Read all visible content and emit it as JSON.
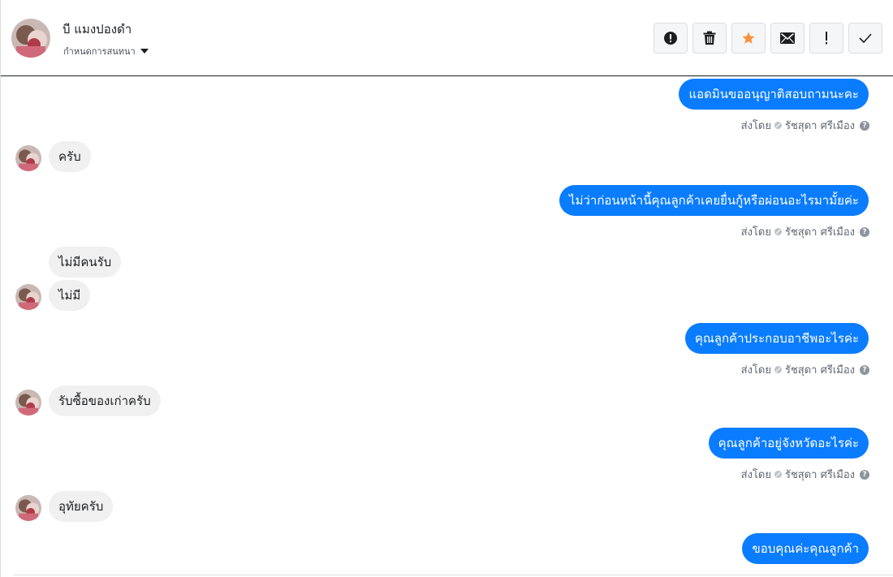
{
  "header": {
    "contact_name": "บี แมงปองดำ",
    "assign_label": "กำหนดการสนทนา",
    "action_icons": [
      "alert-circle-icon",
      "trash-icon",
      "star-icon",
      "envelope-icon",
      "exclamation-icon",
      "checkmark-icon"
    ],
    "star_color": "#f7923a"
  },
  "sent_by": {
    "prefix": "ส่งโดย",
    "name": "รัชสุดา ศรีเมือง"
  },
  "messages": [
    {
      "dir": "out",
      "text": "แอดมินขออนุญาติสอบถามนะคะ",
      "sent_by": true
    },
    {
      "dir": "in",
      "text": "ครับ",
      "avatar": true
    },
    {
      "dir": "out",
      "text": "ไม่ว่าก่อนหน้านี้คุณลูกค้าเคยยื่นกู้หรือผ่อนอะไรมามั้ยค่ะ",
      "sent_by": true
    },
    {
      "dir": "in",
      "text": "ไม่มีคนรับ",
      "avatar": false
    },
    {
      "dir": "in",
      "text": "ไม่มี",
      "avatar": true
    },
    {
      "dir": "out",
      "text": "คุณลูกค้าประกอบอาชีพอะไรค่ะ",
      "sent_by": true
    },
    {
      "dir": "in",
      "text": "รับซื้อของเก่าครับ",
      "avatar": true
    },
    {
      "dir": "out",
      "text": "คุณลูกค้าอยู่จังหวัดอะไรค่ะ",
      "sent_by": true
    },
    {
      "dir": "in",
      "text": "อุทัยครับ",
      "avatar": true
    },
    {
      "dir": "out",
      "text": "ขอบคุณค่ะคุณลูกค้า",
      "sent_by": false
    }
  ],
  "colors": {
    "outgoing_bubble": "#0a7cff",
    "incoming_bubble": "#f0f0f0"
  }
}
